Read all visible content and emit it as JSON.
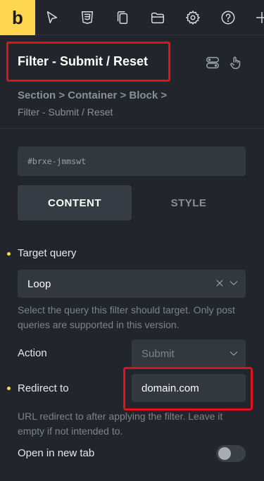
{
  "app": {
    "logo_letter": "b",
    "brand_color": "#ffd64f",
    "toolbar_icons": [
      "cursor-icon",
      "css3-icon",
      "copy-icon",
      "folder-icon",
      "gear-icon",
      "help-icon",
      "plus-icon"
    ]
  },
  "panel": {
    "title": "Filter - Submit / Reset",
    "header_icons": [
      "toggle-icon",
      "pointer-hand-icon"
    ],
    "breadcrumb": "Section > Container > Block >",
    "breadcrumb_current": "Filter - Submit / Reset",
    "element_id": "#brxe-jmmswt"
  },
  "tabs": [
    {
      "label": "CONTENT",
      "active": true
    },
    {
      "label": "STYLE",
      "active": false
    }
  ],
  "fields": {
    "target_query": {
      "label": "Target query",
      "value": "Loop",
      "help": "Select the query this filter should target. Only post queries are supported in this version."
    },
    "action": {
      "label": "Action",
      "placeholder": "Submit"
    },
    "redirect_to": {
      "label": "Redirect to",
      "value": "domain.com",
      "help": "URL redirect to after applying the filter. Leave it empty if not intended to."
    },
    "open_new_tab": {
      "label": "Open in new tab",
      "enabled": false
    }
  },
  "colors": {
    "highlight_border": "#e1121c",
    "background": "#22262c",
    "input_bg": "#33383f"
  }
}
